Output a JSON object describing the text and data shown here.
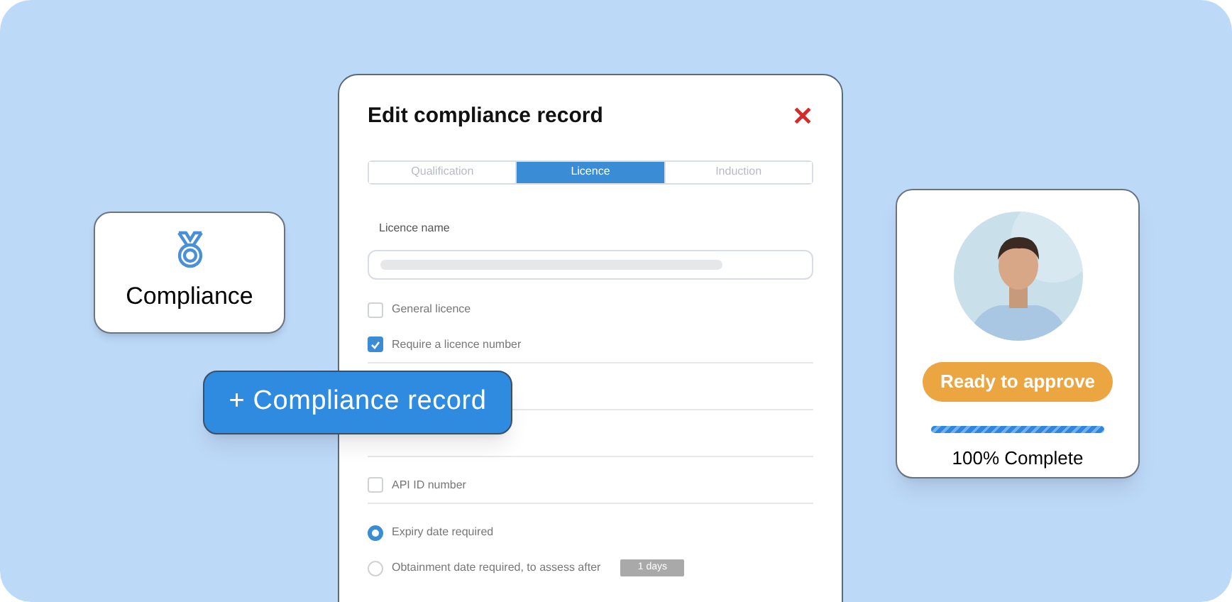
{
  "modal": {
    "title": "Edit compliance record",
    "close": "✕",
    "tabs": [
      {
        "label": "Qualification",
        "selected": false
      },
      {
        "label": "Licence",
        "selected": true
      },
      {
        "label": "Induction",
        "selected": false
      }
    ],
    "field_label": "Licence name",
    "options": [
      {
        "kind": "checkbox",
        "label": "General licence",
        "checked": false,
        "divider_after": false
      },
      {
        "kind": "checkbox",
        "label": "Require a licence number",
        "checked": true,
        "divider_after": true
      },
      {
        "kind": "blank",
        "divider_after": true
      },
      {
        "kind": "blank",
        "divider_after": true
      },
      {
        "kind": "checkbox",
        "label": "API ID number",
        "checked": false,
        "divider_after": true
      },
      {
        "kind": "radio",
        "label": "Expiry date required",
        "selected": true,
        "divider_after": false
      },
      {
        "kind": "radio",
        "label": "Obtainment date required, to assess after",
        "selected": false,
        "chip": "1 days",
        "divider_after": false
      }
    ]
  },
  "compliance_card": {
    "label": "Compliance"
  },
  "add_button": {
    "label": "+ Compliance record"
  },
  "profile_card": {
    "kind": "picture",
    "status": "Ready to approve",
    "progress": {
      "level": 1
    },
    "progress_text": "100% Complete"
  }
}
